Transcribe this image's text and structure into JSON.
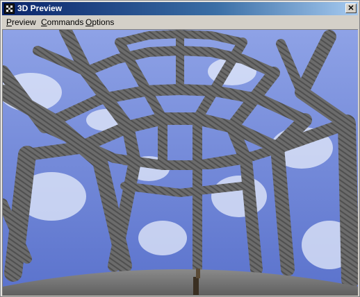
{
  "window": {
    "title": "3D Preview",
    "close_glyph": "✕",
    "app_icon": "grid-app-icon"
  },
  "menu": {
    "items": [
      {
        "mnemonic": "P",
        "rest": "review"
      },
      {
        "mnemonic": "C",
        "rest": "ommands"
      },
      {
        "mnemonic": "O",
        "rest": "ptions"
      }
    ]
  },
  "scene": {
    "sky_color": "#6f86d6",
    "cloud_color": "#e6ecfb",
    "beam_color": "#6c6c6c",
    "floor_color": "#7a7a7a"
  }
}
